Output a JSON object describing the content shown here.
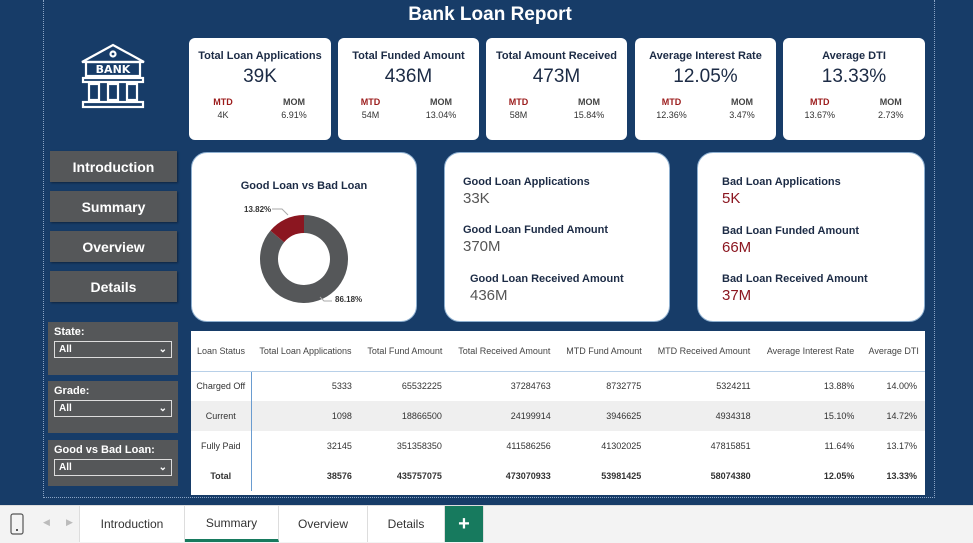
{
  "title": "Bank Loan Report",
  "logo_text": "BANK",
  "nav": [
    "Introduction",
    "Summary",
    "Overview",
    "Details"
  ],
  "filters": [
    {
      "label": "State:",
      "value": "All"
    },
    {
      "label": "Grade:",
      "value": "All"
    },
    {
      "label": "Good vs Bad Loan:",
      "value": "All"
    }
  ],
  "kpis": [
    {
      "title": "Total Loan Applications",
      "value": "39K",
      "mtd_label": "MTD",
      "mtd": "4K",
      "mom_label": "MOM",
      "mom": "6.91%"
    },
    {
      "title": "Total Funded Amount",
      "value": "436M",
      "mtd_label": "MTD",
      "mtd": "54M",
      "mom_label": "MOM",
      "mom": "13.04%"
    },
    {
      "title": "Total Amount Received",
      "value": "473M",
      "mtd_label": "MTD",
      "mtd": "58M",
      "mom_label": "MOM",
      "mom": "15.84%"
    },
    {
      "title": "Average Interest Rate",
      "value": "12.05%",
      "mtd_label": "MTD",
      "mtd": "12.36%",
      "mom_label": "MOM",
      "mom": "3.47%"
    },
    {
      "title": "Average DTI",
      "value": "13.33%",
      "mtd_label": "MTD",
      "mtd": "13.67%",
      "mom_label": "MOM",
      "mom": "2.73%"
    }
  ],
  "donut": {
    "title": "Good Loan vs Bad Loan",
    "bad_pct": 13.82,
    "good_pct": 86.18,
    "bad_label": "13.82%",
    "good_label": "86.18%",
    "bad_color": "#8b1620",
    "good_color": "#555759"
  },
  "good": {
    "apps_label": "Good Loan Applications",
    "apps": "33K",
    "funded_label": "Good Loan Funded Amount",
    "funded": "370M",
    "received_label": "Good Loan Received Amount",
    "received": "436M"
  },
  "bad": {
    "apps_label": "Bad Loan Applications",
    "apps": "5K",
    "funded_label": "Bad Loan Funded Amount",
    "funded": "66M",
    "received_label": "Bad Loan Received Amount",
    "received": "37M"
  },
  "table": {
    "headers": [
      "Loan Status",
      "Total Loan Applications",
      "Total Fund Amount",
      "Total Received Amount",
      "MTD Fund Amount",
      "MTD Received Amount",
      "Average Interest Rate",
      "Average DTI"
    ],
    "rows": [
      [
        "Charged Off",
        "5333",
        "65532225",
        "37284763",
        "8732775",
        "5324211",
        "13.88%",
        "14.00%"
      ],
      [
        "Current",
        "1098",
        "18866500",
        "24199914",
        "3946625",
        "4934318",
        "15.10%",
        "14.72%"
      ],
      [
        "Fully Paid",
        "32145",
        "351358350",
        "411586256",
        "41302025",
        "47815851",
        "11.64%",
        "13.17%"
      ],
      [
        "Total",
        "38576",
        "435757075",
        "473070933",
        "53981425",
        "58074380",
        "12.05%",
        "13.33%"
      ]
    ]
  },
  "tabs": [
    "Introduction",
    "Summary",
    "Overview",
    "Details"
  ],
  "active_tab": "Summary",
  "add_tab": "+"
}
